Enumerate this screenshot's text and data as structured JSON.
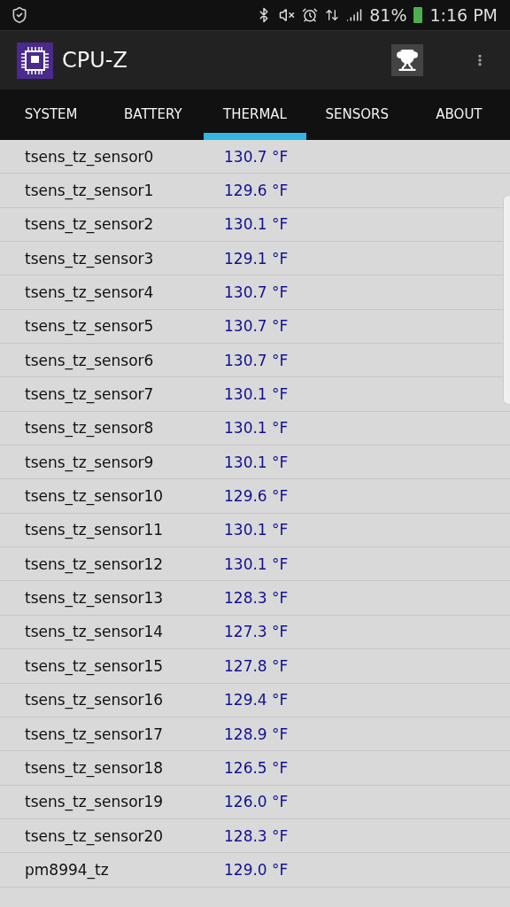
{
  "status_bar": {
    "battery": "81%",
    "time": "1:16 PM"
  },
  "app_bar": {
    "title": "CPU-Z"
  },
  "tabs": [
    {
      "label": "SYSTEM",
      "selected": false
    },
    {
      "label": "BATTERY",
      "selected": false
    },
    {
      "label": "THERMAL",
      "selected": true
    },
    {
      "label": "SENSORS",
      "selected": false
    },
    {
      "label": "ABOUT",
      "selected": false
    }
  ],
  "rows": [
    {
      "name": "tsens_tz_sensor0",
      "value": "130.7 °F"
    },
    {
      "name": "tsens_tz_sensor1",
      "value": "129.6 °F"
    },
    {
      "name": "tsens_tz_sensor2",
      "value": "130.1 °F"
    },
    {
      "name": "tsens_tz_sensor3",
      "value": "129.1 °F"
    },
    {
      "name": "tsens_tz_sensor4",
      "value": "130.7 °F"
    },
    {
      "name": "tsens_tz_sensor5",
      "value": "130.7 °F"
    },
    {
      "name": "tsens_tz_sensor6",
      "value": "130.7 °F"
    },
    {
      "name": "tsens_tz_sensor7",
      "value": "130.1 °F"
    },
    {
      "name": "tsens_tz_sensor8",
      "value": "130.1 °F"
    },
    {
      "name": "tsens_tz_sensor9",
      "value": "130.1 °F"
    },
    {
      "name": "tsens_tz_sensor10",
      "value": "129.6 °F"
    },
    {
      "name": "tsens_tz_sensor11",
      "value": "130.1 °F"
    },
    {
      "name": "tsens_tz_sensor12",
      "value": "130.1 °F"
    },
    {
      "name": "tsens_tz_sensor13",
      "value": "128.3 °F"
    },
    {
      "name": "tsens_tz_sensor14",
      "value": "127.3 °F"
    },
    {
      "name": "tsens_tz_sensor15",
      "value": "127.8 °F"
    },
    {
      "name": "tsens_tz_sensor16",
      "value": "129.4 °F"
    },
    {
      "name": "tsens_tz_sensor17",
      "value": "128.9 °F"
    },
    {
      "name": "tsens_tz_sensor18",
      "value": "126.5 °F"
    },
    {
      "name": "tsens_tz_sensor19",
      "value": "126.0 °F"
    },
    {
      "name": "tsens_tz_sensor20",
      "value": "128.3 °F"
    },
    {
      "name": "pm8994_tz",
      "value": "129.0 °F"
    }
  ]
}
